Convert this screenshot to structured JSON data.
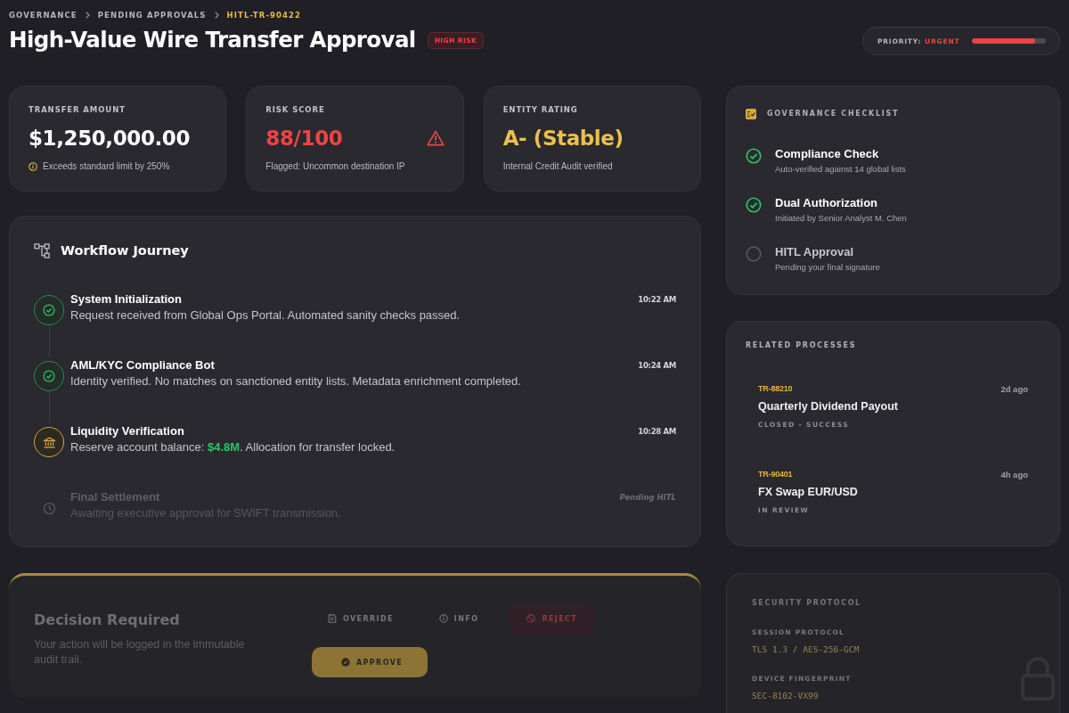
{
  "breadcrumb": [
    {
      "label": "GOVERNANCE",
      "current": false
    },
    {
      "label": "PENDING APPROVALS",
      "current": false
    },
    {
      "label": "HITL-TR-90422",
      "current": true
    }
  ],
  "header": {
    "title": "High-Value Wire Transfer Approval",
    "badge": "HIGH RISK",
    "priority": {
      "label": "PRIORITY:",
      "value": "URGENT",
      "level": 0.85
    }
  },
  "metrics": [
    {
      "kind": "amount",
      "label": "TRANSFER AMOUNT",
      "value": "$1,250,000.00",
      "note": "Exceeds standard limit by 250%"
    },
    {
      "kind": "risk",
      "label": "RISK SCORE",
      "value": "88/100",
      "note": "Flagged: Uncommon destination IP"
    },
    {
      "kind": "rating",
      "label": "ENTITY RATING",
      "value": "A- (Stable)",
      "note": "Internal Credit Audit verified"
    }
  ],
  "workflow": {
    "title": "Workflow Journey",
    "steps": [
      {
        "kind": "done",
        "title": "System Initialization",
        "description": "Request received from Global Ops Portal. Automated sanity checks passed.",
        "time": "10:22 AM"
      },
      {
        "kind": "done",
        "title": "AML/KYC Compliance Bot",
        "description": "Identity verified. No matches on sanctioned entity lists. Metadata enrichment completed.",
        "time": "10:24 AM"
      },
      {
        "kind": "active",
        "title": "Liquidity Verification",
        "description": "Reserve account balance: **$4.8M**. Allocation for transfer locked.",
        "time": "10:28 AM"
      },
      {
        "kind": "pending",
        "title": "Final Settlement",
        "description": "Awaiting executive approval for SWIFT transmission.",
        "time": "Pending HITL"
      }
    ]
  },
  "checklist": {
    "title": "GOVERNANCE CHECKLIST",
    "items": [
      {
        "title": "Compliance Check",
        "subtitle": "Auto-verified against 14 global lists",
        "checked": true
      },
      {
        "title": "Dual Authorization",
        "subtitle": "Initiated by Senior Analyst M. Chen",
        "checked": true
      },
      {
        "title": "HITL Approval",
        "subtitle": "Pending your final signature",
        "checked": false
      }
    ]
  },
  "related": {
    "title": "RELATED PROCESSES",
    "items": [
      {
        "id": "TR-88210",
        "time": "2d ago",
        "name": "Quarterly Dividend Payout",
        "status": "CLOSED - SUCCESS"
      },
      {
        "id": "TR-90401",
        "time": "4h ago",
        "name": "FX Swap EUR/USD",
        "status": "IN REVIEW"
      }
    ]
  },
  "decision": {
    "title": "Decision Required",
    "description": "Your action will be logged in the immutable audit trail.",
    "buttons": [
      {
        "kind": "override",
        "label": "OVERRIDE"
      },
      {
        "kind": "info",
        "label": "INFO"
      },
      {
        "kind": "reject",
        "label": "REJECT"
      },
      {
        "kind": "approve",
        "label": "APPROVE"
      }
    ]
  },
  "security": {
    "title": "SECURITY PROTOCOL",
    "fields": [
      {
        "label": "SESSION PROTOCOL",
        "value": "TLS 1.3 / AES-256-GCM"
      },
      {
        "label": "DEVICE FINGERPRINT",
        "value": "SEC-8102-VX99"
      }
    ]
  }
}
